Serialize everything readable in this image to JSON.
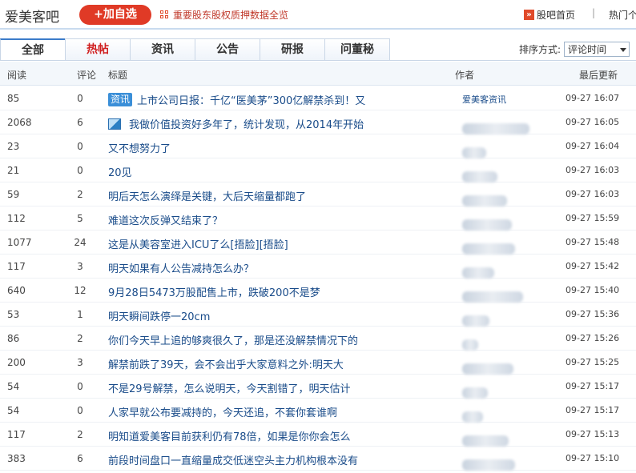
{
  "header": {
    "bar_title": "爱美客吧",
    "add_button": "+加自选",
    "pledge_link": "重要股东股权质押数据全览",
    "home_link": "股吧首页",
    "separator": "|",
    "hot_people": "热门个"
  },
  "tabs": [
    "全部",
    "热帖",
    "资讯",
    "公告",
    "研报",
    "问董秘"
  ],
  "sort": {
    "label": "排序方式:",
    "value": "评论时间"
  },
  "columns": {
    "read": "阅读",
    "comments": "评论",
    "title": "标题",
    "author": "作者",
    "updated": "最后更新"
  },
  "rows": [
    {
      "read": "85",
      "comments": "0",
      "tag": "资讯",
      "title": "上市公司日报：千亿“医美茅”300亿解禁杀到！又",
      "author": "爱美客资讯",
      "time": "09-27 16:07"
    },
    {
      "read": "2068",
      "comments": "6",
      "icon": "image-icon",
      "title": "我做价值投资好多年了，统计发现，从2014年开始",
      "author": "",
      "time": "09-27 16:05"
    },
    {
      "read": "23",
      "comments": "0",
      "title": "又不想努力了",
      "author": "",
      "time": "09-27 16:04"
    },
    {
      "read": "21",
      "comments": "0",
      "title": "20见",
      "author": "",
      "time": "09-27 16:03"
    },
    {
      "read": "59",
      "comments": "2",
      "title": "明后天怎么演绎是关键，大后天缩量都跑了",
      "author": "",
      "time": "09-27 16:03"
    },
    {
      "read": "112",
      "comments": "5",
      "title": "难道这次反弹又结束了？",
      "author": "",
      "time": "09-27 15:59"
    },
    {
      "read": "1077",
      "comments": "24",
      "title": "这是从美容室进入ICU了么[捂脸][捂脸]",
      "author": "",
      "time": "09-27 15:48"
    },
    {
      "read": "117",
      "comments": "3",
      "title": "明天如果有人公告减持怎么办？",
      "author": "",
      "time": "09-27 15:42"
    },
    {
      "read": "640",
      "comments": "12",
      "title": "9月28日5473万股配售上市，跌破200不是梦",
      "author": "",
      "time": "09-27 15:40"
    },
    {
      "read": "53",
      "comments": "1",
      "title": "明天瞬间跌停一20cm",
      "author": "",
      "time": "09-27 15:36"
    },
    {
      "read": "86",
      "comments": "2",
      "title": "你们今天早上追的够爽很久了，那是还没解禁情况下的",
      "author": "",
      "time": "09-27 15:26"
    },
    {
      "read": "200",
      "comments": "3",
      "title": "解禁前跌了39天，会不会出乎大家意料之外:明天大",
      "author": "",
      "time": "09-27 15:25"
    },
    {
      "read": "54",
      "comments": "0",
      "title": "不是29号解禁，怎么说明天，今天割错了，明天估计",
      "author": "",
      "time": "09-27 15:17"
    },
    {
      "read": "54",
      "comments": "0",
      "title": "人家早就公布要减持的，今天还追，不套你套谁啊",
      "author": "",
      "time": "09-27 15:17"
    },
    {
      "read": "117",
      "comments": "2",
      "title": "明知道爱美客目前获利仍有78倍，如果是你你会怎么",
      "author": "",
      "time": "09-27 15:13"
    },
    {
      "read": "383",
      "comments": "6",
      "title": "前段时间盘口一直缩量成交低迷空头主力机构根本没有",
      "author": "",
      "time": "09-27 15:10"
    }
  ]
}
